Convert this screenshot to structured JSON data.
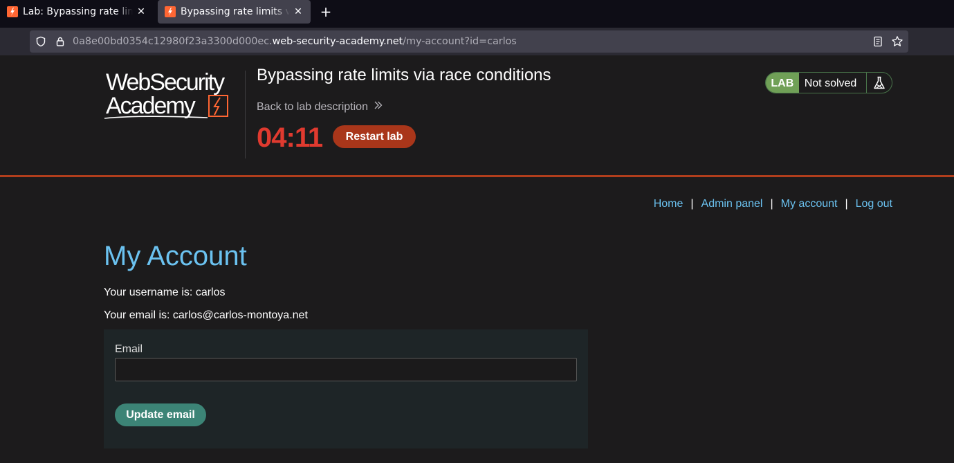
{
  "browser": {
    "tabs": [
      {
        "title": "Lab: Bypassing rate limits via race conditions",
        "active": false
      },
      {
        "title": "Bypassing rate limits via race conditions",
        "active": true
      }
    ],
    "new_tab_label": "+",
    "close_label": "✕",
    "url": {
      "prefix": "0a8e00bd0354c12980f23a3300d000ec.",
      "domain": "web-security-academy.net",
      "path": "/my-account?id=carlos"
    }
  },
  "lab": {
    "logo_line1": "WebSecurity",
    "logo_line2": "Academy",
    "title": "Bypassing rate limits via race conditions",
    "back_link": "Back to lab description",
    "timer": "04:11",
    "restart_label": "Restart lab",
    "status_tag": "LAB",
    "status_text": "Not solved"
  },
  "nav": {
    "items": [
      {
        "label": "Home"
      },
      {
        "label": "Admin panel"
      },
      {
        "label": "My account"
      },
      {
        "label": "Log out"
      }
    ],
    "separator": "|"
  },
  "account": {
    "heading": "My Account",
    "username_line": "Your username is: carlos",
    "email_line": "Your email is: carlos@carlos-montoya.net",
    "form": {
      "email_label": "Email",
      "email_value": "",
      "email_placeholder": "",
      "submit_label": "Update email"
    }
  },
  "colors": {
    "accent_orange": "#b13e1c",
    "link_blue": "#6bc2f0",
    "timer_red": "#e03a2f",
    "lab_green": "#70a057",
    "button_teal": "#3c8476"
  }
}
